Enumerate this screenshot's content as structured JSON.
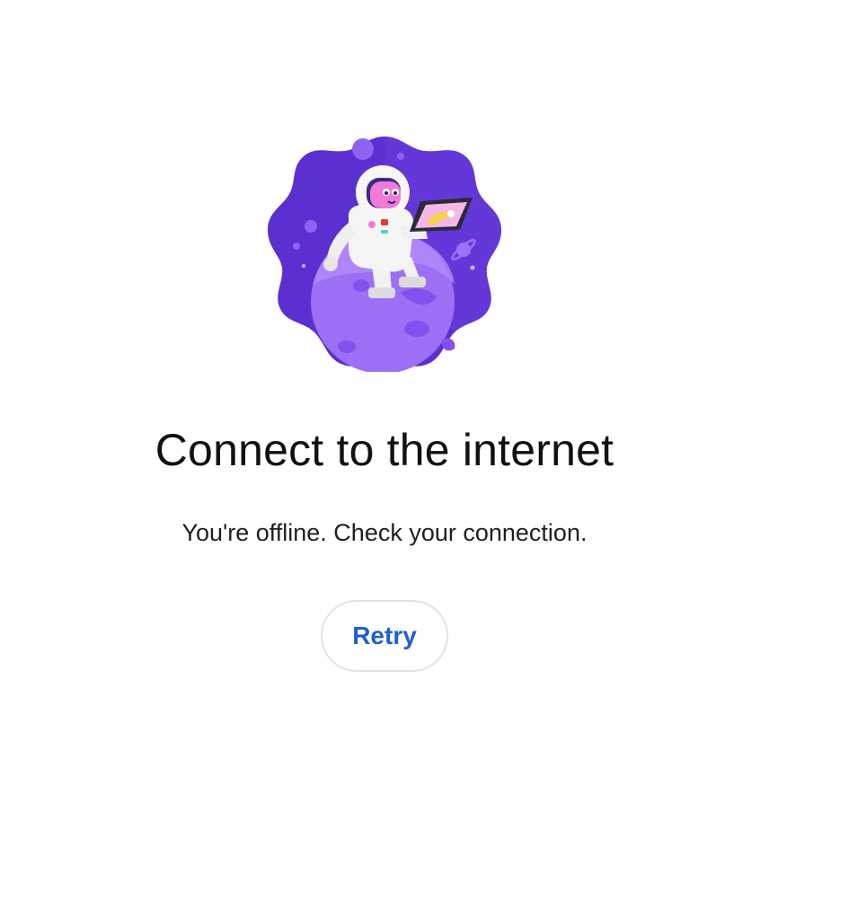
{
  "illustration": {
    "icon": "astronaut-on-planet-icon",
    "colors": {
      "background": "#5b2fd0",
      "background_light": "#7b4be6",
      "planet": "#a57cf7",
      "planet_dark": "#8a5cf0",
      "suit": "#f2f2f2",
      "face": "#f07ad7",
      "tablet_screen": "#f5d34a"
    }
  },
  "offline": {
    "title": "Connect to the internet",
    "message": "You're offline. Check your connection.",
    "retry_label": "Retry"
  },
  "colors": {
    "accent": "#1f5fcf",
    "button_border": "#e3e3e3",
    "text": "#111111"
  }
}
